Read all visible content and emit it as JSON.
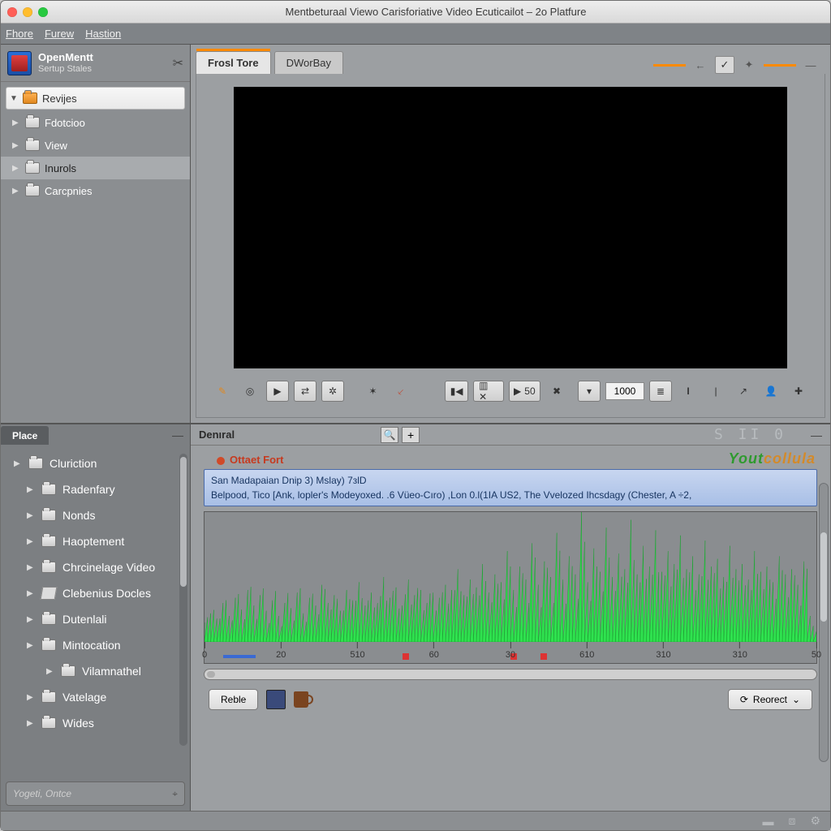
{
  "title": "Mentbeturaal Viewo Carisforiative Video Ecuticailot – 2o Platfure",
  "menu": [
    "Fhore",
    "Furew",
    "Hastion"
  ],
  "nav": {
    "app_name": "OpenMentt",
    "app_sub": "Sertup Stales",
    "root": "Revijes",
    "items": [
      {
        "label": "Fdotcioo"
      },
      {
        "label": "View"
      },
      {
        "label": "Inurols",
        "selected": true
      },
      {
        "label": "Carcpnies"
      }
    ]
  },
  "preview": {
    "tabs": [
      {
        "label": "Frosl Tore",
        "active": true
      },
      {
        "label": "DWorBay",
        "active": false
      }
    ],
    "transport": {
      "speed_value": "50",
      "num_value": "1000"
    }
  },
  "place": {
    "title": "Place",
    "items": [
      {
        "label": "Cluriction",
        "level": 1
      },
      {
        "label": "Radenfary",
        "level": 2
      },
      {
        "label": "Nonds",
        "level": 2
      },
      {
        "label": "Haoptement",
        "level": 2
      },
      {
        "label": "Chrcinelage Video",
        "level": 2
      },
      {
        "label": "Clebenius Docles",
        "level": 2,
        "doc": true
      },
      {
        "label": "Dutenlali",
        "level": 2
      },
      {
        "label": "Mintocation",
        "level": 2
      },
      {
        "label": "Vilamnathel",
        "level": 3
      },
      {
        "label": "Vatelage",
        "level": 2
      },
      {
        "label": "Wides",
        "level": 2
      }
    ],
    "search_placeholder": "Yogeti, Ontce"
  },
  "timeline": {
    "title": "Denıral",
    "counter": "S II 0",
    "fort_label": "Ottaet Fort",
    "brand_a": "Yout",
    "brand_b": "collula",
    "clip_line1": "San Madapaian Dnip 3) Mslay) 7зlD",
    "clip_line2": "Belpood, Tico [Ank, lopler's Modeуoxed.  .6 Vüeo-Cıro) ,Lon 0.l(1IA  US2,  The  Vvelozed  Ihcsdagy  (Chester,  A ÷2,",
    "ticks": [
      "0",
      "20",
      "510",
      "60",
      "30",
      "610",
      "310",
      "310",
      "50"
    ],
    "footer": {
      "btn1": "Reble",
      "btn2": "Reorect"
    }
  },
  "chart_data": {
    "type": "area",
    "title": "Audio waveform",
    "xlabel": "",
    "ylabel": "",
    "x": [
      0,
      1,
      2,
      3,
      4,
      5,
      6,
      7,
      8,
      9,
      10,
      11,
      12,
      13,
      14,
      15,
      16,
      17,
      18,
      19,
      20,
      21,
      22,
      23,
      24,
      25,
      26,
      27,
      28,
      29,
      30,
      31,
      32,
      33,
      34,
      35,
      36,
      37,
      38,
      39,
      40,
      41,
      42,
      43,
      44,
      45,
      46,
      47,
      48,
      49,
      50,
      51,
      52,
      53,
      54,
      55,
      56,
      57,
      58,
      59,
      60,
      61,
      62,
      63,
      64,
      65,
      66,
      67,
      68,
      69,
      70,
      71,
      72,
      73,
      74,
      75,
      76,
      77,
      78,
      79,
      80,
      81,
      82,
      83,
      84,
      85,
      86,
      87,
      88,
      89,
      90,
      91,
      92,
      93,
      94,
      95,
      96,
      97,
      98,
      99
    ],
    "values": [
      15,
      22,
      18,
      30,
      20,
      34,
      25,
      40,
      28,
      36,
      24,
      32,
      20,
      30,
      26,
      38,
      22,
      34,
      28,
      44,
      30,
      36,
      24,
      40,
      32,
      46,
      28,
      38,
      30,
      50,
      34,
      42,
      28,
      48,
      36,
      40,
      30,
      38,
      34,
      44,
      40,
      56,
      36,
      48,
      42,
      60,
      38,
      52,
      46,
      70,
      40,
      58,
      48,
      76,
      44,
      62,
      50,
      84,
      48,
      66,
      52,
      100,
      46,
      72,
      54,
      88,
      50,
      68,
      56,
      94,
      52,
      74,
      58,
      86,
      54,
      70,
      60,
      82,
      56,
      66,
      52,
      78,
      58,
      64,
      50,
      74,
      56,
      60,
      48,
      70,
      54,
      58,
      46,
      66,
      52,
      56,
      44,
      62,
      20,
      8
    ],
    "ylim": [
      0,
      100
    ]
  }
}
